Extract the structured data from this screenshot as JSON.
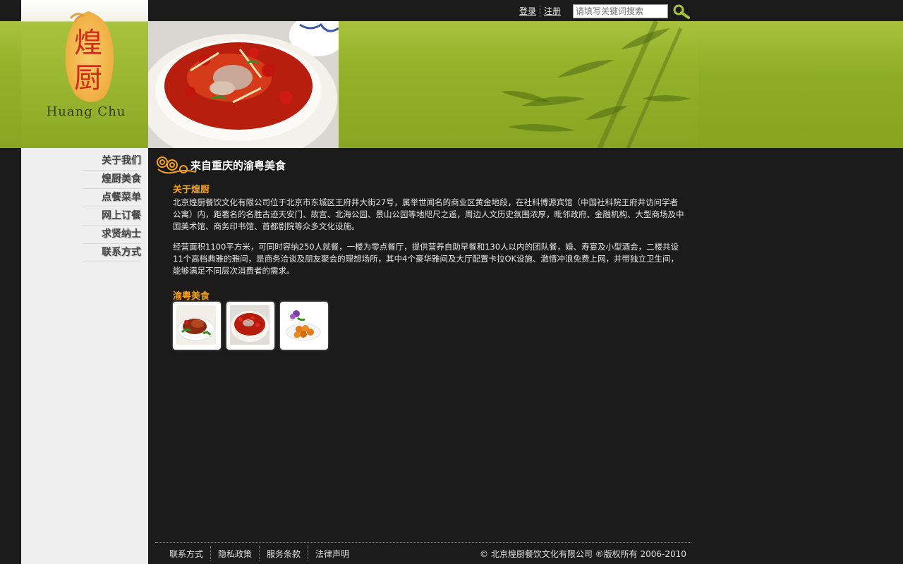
{
  "header": {
    "login_label": "登录",
    "register_label": "注册",
    "search_placeholder": "请填写关键词搜索",
    "logo_caption": "Huang Chu",
    "logo_chars": [
      "煌",
      "厨"
    ]
  },
  "sidebar": {
    "items": [
      {
        "label": "关于我们"
      },
      {
        "label": "煌厨美食"
      },
      {
        "label": "点餐菜单"
      },
      {
        "label": "网上订餐"
      },
      {
        "label": "求贤纳士"
      },
      {
        "label": "联系方式"
      }
    ]
  },
  "main": {
    "title": "来自重庆的渝粤美食",
    "about": {
      "heading": "关于煌厨",
      "p1": "北京煌厨餐饮文化有限公司位于北京市东城区王府井大街27号，属举世闻名的商业区黄金地段，在社科博源宾馆（中国社科院王府井访问学者公寓）内，距著名的名胜古迹天安门、故宫、北海公园、景山公园等地咫尺之遥，周边人文历史氛围浓厚，毗邻政府、金融机构、大型商场及中国美术馆、商务印书馆、首都剧院等众多文化设施。",
      "p2": "经营面积1100平方米，可同时容纳250人就餐，一楼为零点餐厅，提供营养自助早餐和130人以内的团队餐，婚、寿宴及小型酒会，二楼共设11个高档典雅的雅间，是商务洽谈及朋友聚会的理想场所，其中4个豪华雅间及大厅配置卡拉OK设施、激情冲浪免费上网，并带独立卫生间，能够满足不同层次消费者的需求。"
    },
    "food": {
      "heading": "渝粤美食",
      "thumbs": [
        {
          "name": "roast-duck-dish"
        },
        {
          "name": "spicy-fish-soup"
        },
        {
          "name": "fried-shrimp-dish"
        }
      ]
    }
  },
  "footer": {
    "links": [
      "联系方式",
      "隐私政策",
      "服务条款",
      "法律声明"
    ],
    "copyright": "© 北京煌厨餐饮文化有限公司 ®版权所有 2006-2010"
  },
  "colors": {
    "accent_orange": "#f5a21c",
    "banner_green": "#94b22a",
    "background": "#1b1b1b",
    "sidebar": "#efefef"
  }
}
